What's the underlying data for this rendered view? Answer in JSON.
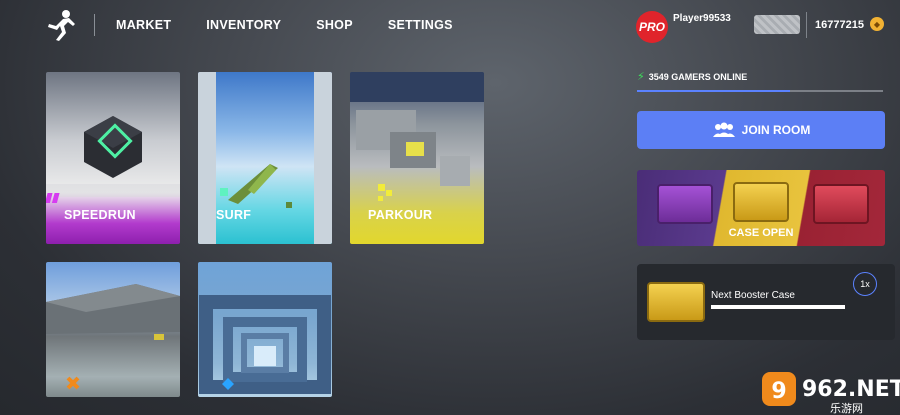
{
  "nav": {
    "items": [
      "MARKET",
      "INVENTORY",
      "SHOP",
      "SETTINGS"
    ]
  },
  "user": {
    "badge": "PRO",
    "name": "Player99533",
    "coins": "16777215"
  },
  "modes": {
    "speedrun": "SPEEDRUN",
    "surf": "SURF",
    "parkour": "PARKOUR"
  },
  "online": {
    "text": "3549 GAMERS ONLINE",
    "level": 0.62
  },
  "join_room": "JOIN ROOM",
  "case_open": "CASE OPEN",
  "booster": {
    "title": "Next Booster Case",
    "multiplier": "1x"
  },
  "watermark": {
    "text": "962.NET",
    "sub": "乐游网"
  },
  "colors": {
    "accent_blue": "#5c7ff5",
    "pro_red": "#e0242b",
    "online_green": "#3de05a"
  },
  "icons": [
    "runner-logo-icon",
    "bolt-icon",
    "users-icon",
    "coin-icon",
    "crate-icon"
  ]
}
